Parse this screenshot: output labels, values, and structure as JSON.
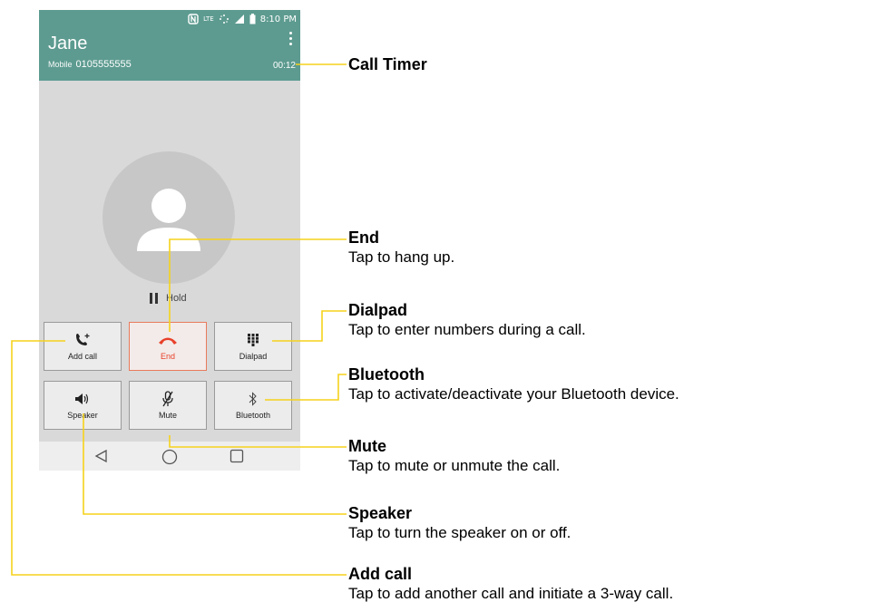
{
  "status_bar": {
    "network": "LTE",
    "time": "8:10 PM"
  },
  "call": {
    "name": "Jane",
    "number_type": "Mobile",
    "number": "0105555555",
    "timer": "00:12",
    "hold_label": "Hold"
  },
  "buttons": [
    {
      "label": "Add call",
      "icon": "add-call-icon"
    },
    {
      "label": "End",
      "icon": "end-call-icon"
    },
    {
      "label": "Dialpad",
      "icon": "dialpad-icon"
    },
    {
      "label": "Speaker",
      "icon": "speaker-icon"
    },
    {
      "label": "Mute",
      "icon": "mute-icon"
    },
    {
      "label": "Bluetooth",
      "icon": "bluetooth-icon"
    }
  ],
  "nav": [
    "back-icon",
    "home-icon",
    "recents-icon"
  ],
  "callouts": [
    {
      "title": "Call Timer",
      "desc": ""
    },
    {
      "title": "End",
      "desc": "Tap to hang up."
    },
    {
      "title": "Dialpad",
      "desc": "Tap to enter numbers during a call."
    },
    {
      "title": "Bluetooth",
      "desc": "Tap to activate/deactivate your Bluetooth device."
    },
    {
      "title": "Mute",
      "desc": "Tap to mute or unmute the call."
    },
    {
      "title": "Speaker",
      "desc": "Tap to turn the speaker on or off."
    },
    {
      "title": "Add call",
      "desc": "Tap to add another call and initiate a 3-way call."
    }
  ],
  "colors": {
    "header": "#5d9b90",
    "end_red": "#e8402a",
    "callout_line": "#f5d21b"
  }
}
